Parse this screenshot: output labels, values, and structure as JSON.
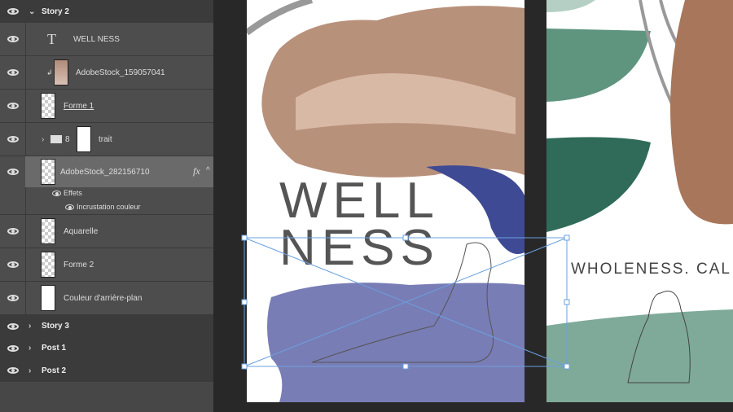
{
  "layers_panel": {
    "groups": [
      {
        "name": "Story 2",
        "expanded": true
      },
      {
        "name": "Story 3"
      },
      {
        "name": "Post 1"
      },
      {
        "name": "Post 2"
      }
    ],
    "layers": [
      {
        "name": "WELL NESS",
        "type": "text",
        "icon": "text-icon"
      },
      {
        "name": "AdobeStock_159057041",
        "type": "smart-object",
        "clipped": true
      },
      {
        "name": "Forme 1",
        "type": "shape"
      },
      {
        "name": "trait",
        "type": "group"
      },
      {
        "name": "AdobeStock_282156710",
        "type": "smart-object",
        "selected": true,
        "fx": "fx"
      },
      {
        "name": "Aquarelle",
        "type": "pixel"
      },
      {
        "name": "Forme 2",
        "type": "smart-object"
      },
      {
        "name": "Couleur d'arrière-plan",
        "type": "shape"
      }
    ],
    "effects": {
      "label": "Effets",
      "items": [
        "Incrustation couleur"
      ]
    }
  },
  "canvas": {
    "artboard1": {
      "title_line1": "WELL",
      "title_line2": "NESS",
      "accent": "#3f4a94",
      "watercolor": "#6a6fad"
    },
    "artboard2": {
      "tagline": "WHOLENESS. CAL",
      "accent": "#2f6b58"
    },
    "selection_color": "#6aa0e0"
  }
}
